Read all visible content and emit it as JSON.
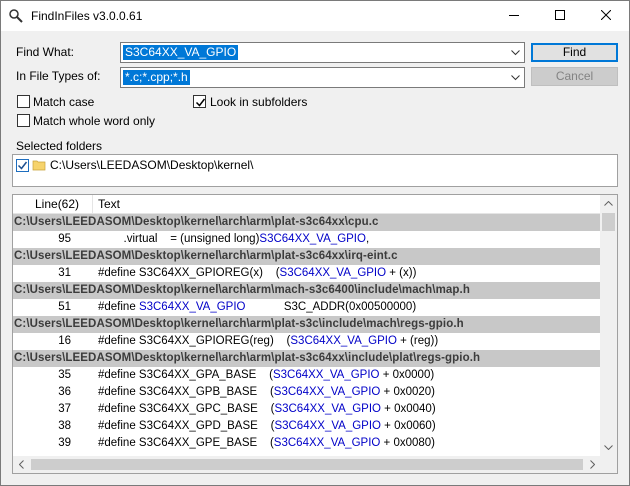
{
  "window": {
    "title": "FindInFiles v3.0.0.61",
    "icons": {
      "app": "magnifier-icon",
      "minimize": "minimize-icon",
      "maximize": "maximize-icon",
      "close": "close-icon"
    }
  },
  "form": {
    "find_what_label": "Find What:",
    "find_what_value": "S3C64XX_VA_GPIO",
    "file_types_label": "In File Types of:",
    "file_types_value": "*.c;*.cpp;*.h",
    "find_button": "Find",
    "cancel_button": "Cancel",
    "match_case_label": "Match case",
    "match_case_checked": false,
    "whole_word_label": "Match whole word only",
    "whole_word_checked": false,
    "subfolders_label": "Look in subfolders",
    "subfolders_checked": true
  },
  "folders": {
    "label": "Selected folders",
    "items": [
      {
        "path": "C:\\Users\\LEEDASOM\\Desktop\\kernel\\",
        "checked": true
      }
    ]
  },
  "results": {
    "columns": {
      "line": "Line(62)",
      "text": "Text"
    },
    "rows": [
      {
        "kind": "file",
        "path": "C:\\Users\\LEEDASOM\\Desktop\\kernel\\arch\\arm\\plat-s3c64xx\\cpu.c"
      },
      {
        "kind": "hit",
        "line": "95",
        "pre": "        .virtual    = (unsigned long)",
        "match": "S3C64XX_VA_GPIO",
        "post": ","
      },
      {
        "kind": "file",
        "path": "C:\\Users\\LEEDASOM\\Desktop\\kernel\\arch\\arm\\plat-s3c64xx\\irq-eint.c"
      },
      {
        "kind": "hit",
        "line": "31",
        "pre": "#define S3C64XX_GPIOREG(x)    (",
        "match": "S3C64XX_VA_GPIO",
        "post": " + (x))"
      },
      {
        "kind": "file",
        "path": "C:\\Users\\LEEDASOM\\Desktop\\kernel\\arch\\arm\\mach-s3c6400\\include\\mach\\map.h"
      },
      {
        "kind": "hit",
        "line": "51",
        "pre": "#define ",
        "match": "S3C64XX_VA_GPIO",
        "post": "            S3C_ADDR(0x00500000)"
      },
      {
        "kind": "file",
        "path": "C:\\Users\\LEEDASOM\\Desktop\\kernel\\arch\\arm\\plat-s3c\\include\\mach\\regs-gpio.h"
      },
      {
        "kind": "hit",
        "line": "16",
        "pre": "#define S3C64XX_GPIOREG(reg)    (",
        "match": "S3C64XX_VA_GPIO",
        "post": " + (reg))"
      },
      {
        "kind": "file",
        "path": "C:\\Users\\LEEDASOM\\Desktop\\kernel\\arch\\arm\\plat-s3c64xx\\include\\plat\\regs-gpio.h"
      },
      {
        "kind": "hit",
        "line": "35",
        "pre": "#define S3C64XX_GPA_BASE    (",
        "match": "S3C64XX_VA_GPIO",
        "post": " + 0x0000)"
      },
      {
        "kind": "hit",
        "line": "36",
        "pre": "#define S3C64XX_GPB_BASE    (",
        "match": "S3C64XX_VA_GPIO",
        "post": " + 0x0020)"
      },
      {
        "kind": "hit",
        "line": "37",
        "pre": "#define S3C64XX_GPC_BASE    (",
        "match": "S3C64XX_VA_GPIO",
        "post": " + 0x0040)"
      },
      {
        "kind": "hit",
        "line": "38",
        "pre": "#define S3C64XX_GPD_BASE    (",
        "match": "S3C64XX_VA_GPIO",
        "post": " + 0x0060)"
      },
      {
        "kind": "hit",
        "line": "39",
        "pre": "#define S3C64XX_GPE_BASE    (",
        "match": "S3C64XX_VA_GPIO",
        "post": " + 0x0080)"
      }
    ]
  },
  "colors": {
    "accent": "#0078d7",
    "match": "#0000c8",
    "file_row": "#c8c8c8"
  }
}
